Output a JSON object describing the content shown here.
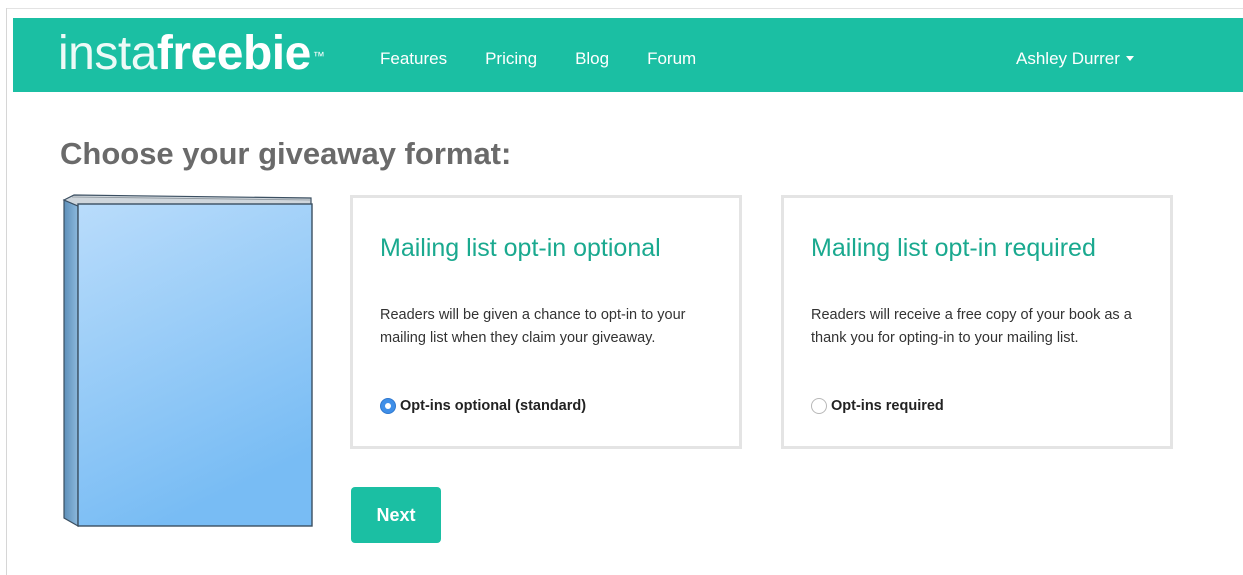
{
  "navbar": {
    "logo_light": "insta",
    "logo_bold": "freebie",
    "logo_tm": "™",
    "links": [
      "Features",
      "Pricing",
      "Blog",
      "Forum"
    ],
    "user_name": "Ashley Durrer",
    "brand_color": "#1bbfa3"
  },
  "page": {
    "title": "Choose your giveaway format:"
  },
  "options": [
    {
      "title": "Mailing list opt-in optional",
      "description": "Readers will be given a chance to opt-in to your mailing list when they claim your giveaway.",
      "radio_label": "Opt-ins optional (standard)",
      "selected": true
    },
    {
      "title": "Mailing list opt-in required",
      "description": "Readers will receive a free copy of your book as a thank you for opting-in to your mailing list.",
      "radio_label": "Opt-ins required",
      "selected": false
    }
  ],
  "actions": {
    "next_label": "Next"
  },
  "colors": {
    "title_accent": "#1aa98f",
    "radio_selected": "#3f8fe8",
    "book_cover": "#9fd0f8"
  }
}
